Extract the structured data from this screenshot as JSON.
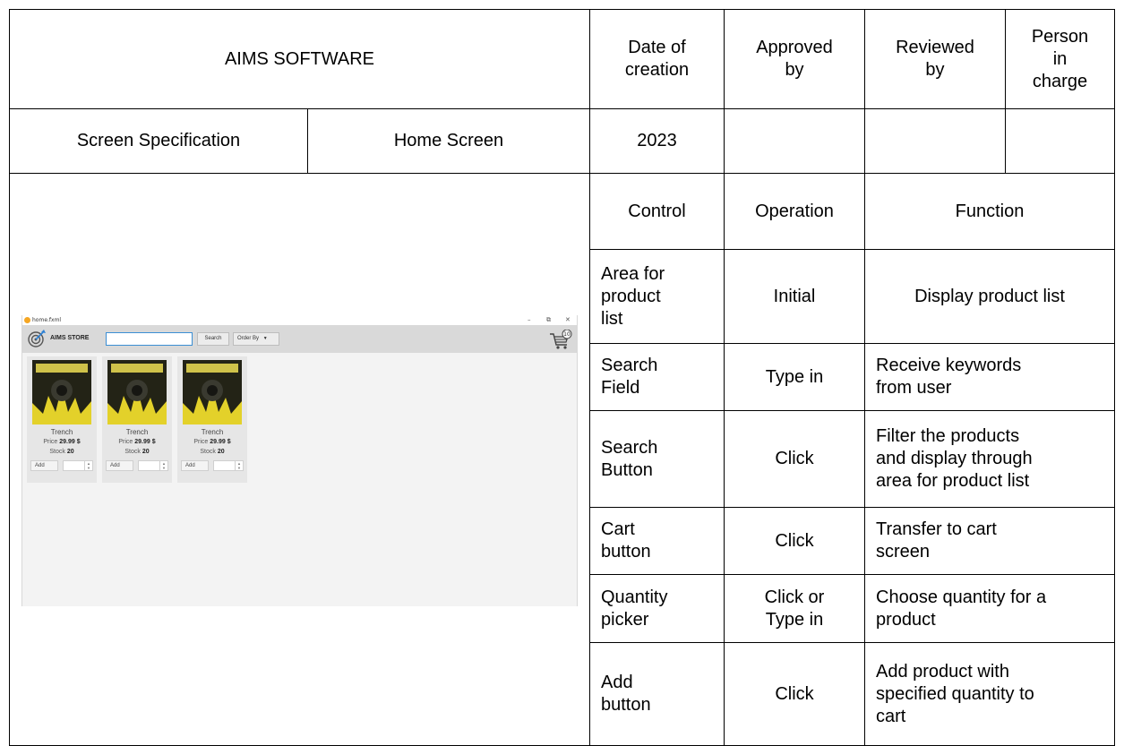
{
  "header": {
    "company": "AIMS SOFTWARE",
    "date_label": "Date of\ncreation",
    "approved_label": "Approved\nby",
    "reviewed_label": "Reviewed\nby",
    "person_label": "Person\nin\ncharge"
  },
  "row2": {
    "doc_type": "Screen Specification",
    "screen_name": "Home Screen",
    "date": "2023",
    "approved_by": "",
    "reviewed_by": "",
    "person_in_charge": ""
  },
  "spec_table": {
    "headers": [
      "Control",
      "Operation",
      "Function"
    ],
    "rows": [
      {
        "control": "Area for\nproduct\nlist",
        "operation": "Initial",
        "function": "Display product list"
      },
      {
        "control": "Search\nField",
        "operation": "Type in",
        "function": "Receive keywords\nfrom user"
      },
      {
        "control": "Search\nButton",
        "operation": "Click",
        "function": "Filter the products\nand display through\narea for product list"
      },
      {
        "control": "Cart\nbutton",
        "operation": "Click",
        "function": "Transfer to cart\nscreen"
      },
      {
        "control": "Quantity\npicker",
        "operation": "Click or\nType in",
        "function": "Choose quantity for a\nproduct"
      },
      {
        "control": "Add\nbutton",
        "operation": "Click",
        "function": "Add product with\nspecified quantity to\ncart"
      }
    ]
  },
  "app": {
    "window_title": "home.fxml",
    "brand": "AIMS STORE",
    "search_value": "",
    "search_button": "Search",
    "order_by": "Order By",
    "cart_count": "10",
    "products": [
      {
        "name": "Trench",
        "price_label": "Price",
        "price": "29.99 $",
        "stock_label": "Stock",
        "stock": "20",
        "add": "Add"
      },
      {
        "name": "Trench",
        "price_label": "Price",
        "price": "29.99 $",
        "stock_label": "Stock",
        "stock": "20",
        "add": "Add"
      },
      {
        "name": "Trench",
        "price_label": "Price",
        "price": "29.99 $",
        "stock_label": "Stock",
        "stock": "20",
        "add": "Add"
      }
    ]
  }
}
